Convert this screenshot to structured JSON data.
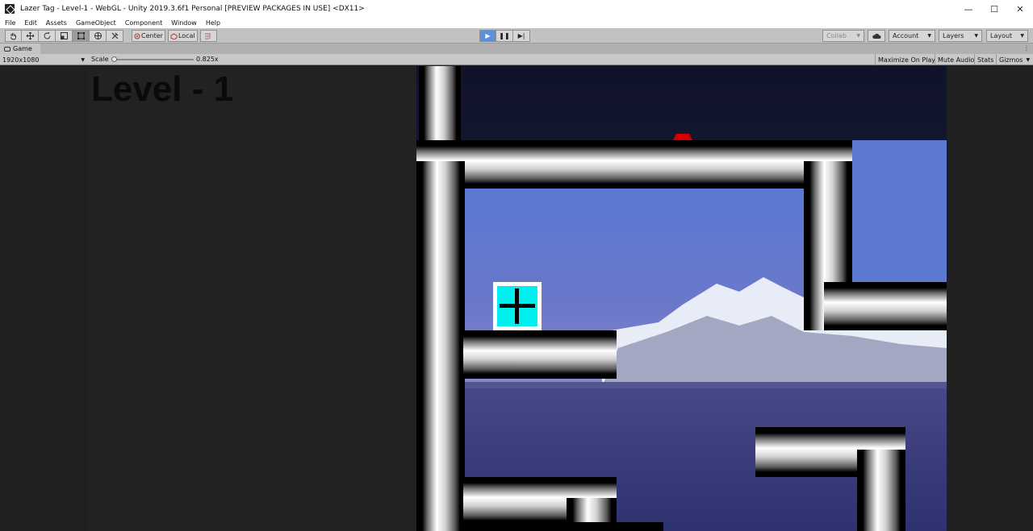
{
  "window": {
    "title": "Lazer Tag - Level-1 - WebGL - Unity 2019.3.6f1 Personal [PREVIEW PACKAGES IN USE] <DX11>",
    "controls": {
      "minimize": "—",
      "maximize": "☐",
      "close": "✕"
    }
  },
  "menu": {
    "items": [
      "File",
      "Edit",
      "Assets",
      "GameObject",
      "Component",
      "Window",
      "Help"
    ]
  },
  "toolbar": {
    "transform_tools": [
      "hand-tool-icon",
      "move-tool-icon",
      "rotate-tool-icon",
      "scale-tool-icon",
      "rect-tool-icon",
      "transform-tool-icon",
      "custom-tool-icon"
    ],
    "pivot_label": "Center",
    "space_label": "Local",
    "play_icon": "▶",
    "pause_icon": "❚❚",
    "step_icon": "▶|",
    "collab_label": "Collab",
    "account_label": "Account",
    "layers_label": "Layers",
    "layout_label": "Layout"
  },
  "game_tab": {
    "label": "Game",
    "menu_icon": "⋮"
  },
  "game_controls": {
    "resolution": "1920x1080",
    "scale_label": "Scale",
    "scale_value": "0.825x",
    "maximize_on_play": "Maximize On Play",
    "mute_audio": "Mute Audio",
    "stats": "Stats",
    "gizmos": "Gizmos"
  },
  "game": {
    "level_title": "Level - 1"
  },
  "colors": {
    "play_active": "#5e8fd9",
    "player_cyan": "#00f0f0",
    "laser_red": "#d40000",
    "sky_dark": "#161a38",
    "sky_blue": "#4e66c4"
  }
}
